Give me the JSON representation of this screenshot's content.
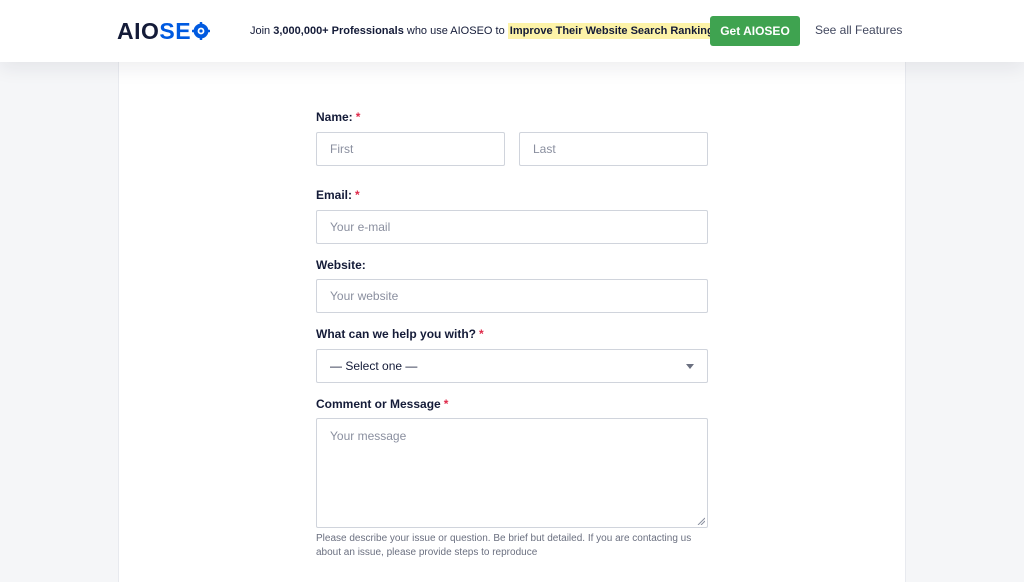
{
  "header": {
    "logo_left": "AIO",
    "logo_right": "SE",
    "logo_last": "O",
    "promo_prefix": "Join ",
    "promo_count": "3,000,000+ Professionals",
    "promo_middle": " who use AIOSEO to ",
    "promo_highlight": "Improve Their Website Search Rankings!",
    "cta_label": "Get AIOSEO",
    "features_link": "See all Features"
  },
  "form": {
    "name": {
      "label": "Name:",
      "required_mark": "*",
      "first_placeholder": "First",
      "last_placeholder": "Last"
    },
    "email": {
      "label": "Email:",
      "required_mark": "*",
      "placeholder": "Your e-mail"
    },
    "website": {
      "label": "Website:",
      "placeholder": "Your website"
    },
    "help_topic": {
      "label": "What can we help you with?",
      "required_mark": "*",
      "selected": "— Select one —"
    },
    "message": {
      "label": "Comment or Message",
      "required_mark": "*",
      "placeholder": "Your message",
      "help_text": "Please describe your issue or question. Be brief but detailed. If you are contacting us about an issue, please provide steps to reproduce"
    }
  },
  "colors": {
    "brand_blue": "#005ae0",
    "cta_green": "#3fa350",
    "required_red": "#df2a4a",
    "highlight_yellow": "#fdf3a8"
  }
}
